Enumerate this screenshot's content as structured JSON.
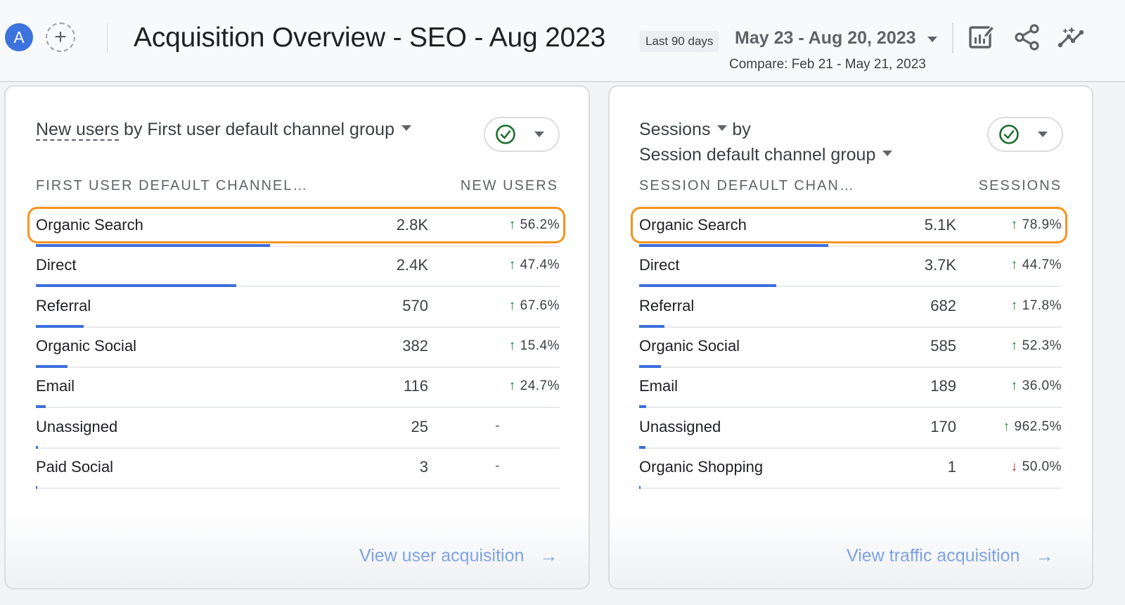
{
  "header": {
    "avatar_letter": "A",
    "add_comparison_icon": "plus-icon",
    "title": "Acquisition Overview - SEO - Aug 2023",
    "range_chip": "Last 90 days",
    "date_range": "May 23 - Aug 20, 2023",
    "compare_text": "Compare: Feb 21 - May 21, 2023",
    "icons": [
      "edit-report-icon",
      "share-icon",
      "insights-icon"
    ]
  },
  "cards": [
    {
      "title_metric": "New users",
      "title_rest": " by First user default channel group",
      "title_line2": "",
      "col_dimension": "FIRST USER DEFAULT CHANNEL…",
      "col_metric": "NEW USERS",
      "max_value": 2800,
      "rows": [
        {
          "name": "Organic Search",
          "value": "2.8K",
          "raw": 2800,
          "change": "56.2%",
          "dir": "up",
          "highlighted": true
        },
        {
          "name": "Direct",
          "value": "2.4K",
          "raw": 2400,
          "change": "47.4%",
          "dir": "up"
        },
        {
          "name": "Referral",
          "value": "570",
          "raw": 570,
          "change": "67.6%",
          "dir": "up"
        },
        {
          "name": "Organic Social",
          "value": "382",
          "raw": 382,
          "change": "15.4%",
          "dir": "up"
        },
        {
          "name": "Email",
          "value": "116",
          "raw": 116,
          "change": "24.7%",
          "dir": "up"
        },
        {
          "name": "Unassigned",
          "value": "25",
          "raw": 25,
          "change": "-",
          "dir": "none"
        },
        {
          "name": "Paid Social",
          "value": "3",
          "raw": 3,
          "change": "-",
          "dir": "none"
        }
      ],
      "link": "View user acquisition"
    },
    {
      "title_metric": "Sessions",
      "title_rest": " by",
      "title_line2": "Session default channel group",
      "col_dimension": "SESSION DEFAULT CHAN…",
      "col_metric": "SESSIONS",
      "max_value": 5100,
      "rows": [
        {
          "name": "Organic Search",
          "value": "5.1K",
          "raw": 5100,
          "change": "78.9%",
          "dir": "up",
          "highlighted": true
        },
        {
          "name": "Direct",
          "value": "3.7K",
          "raw": 3700,
          "change": "44.7%",
          "dir": "up"
        },
        {
          "name": "Referral",
          "value": "682",
          "raw": 682,
          "change": "17.8%",
          "dir": "up"
        },
        {
          "name": "Organic Social",
          "value": "585",
          "raw": 585,
          "change": "52.3%",
          "dir": "up"
        },
        {
          "name": "Email",
          "value": "189",
          "raw": 189,
          "change": "36.0%",
          "dir": "up"
        },
        {
          "name": "Unassigned",
          "value": "170",
          "raw": 170,
          "change": "962.5%",
          "dir": "up"
        },
        {
          "name": "Organic Shopping",
          "value": "1",
          "raw": 1,
          "change": "50.0%",
          "dir": "down"
        }
      ],
      "link": "View traffic acquisition"
    }
  ],
  "colors": {
    "bar": "#3b6fdb",
    "up": "#1e7e34",
    "down": "#c5221f",
    "highlight": "#f7931e",
    "link": "#1a5fd6",
    "avatar": "#3c73dc"
  }
}
